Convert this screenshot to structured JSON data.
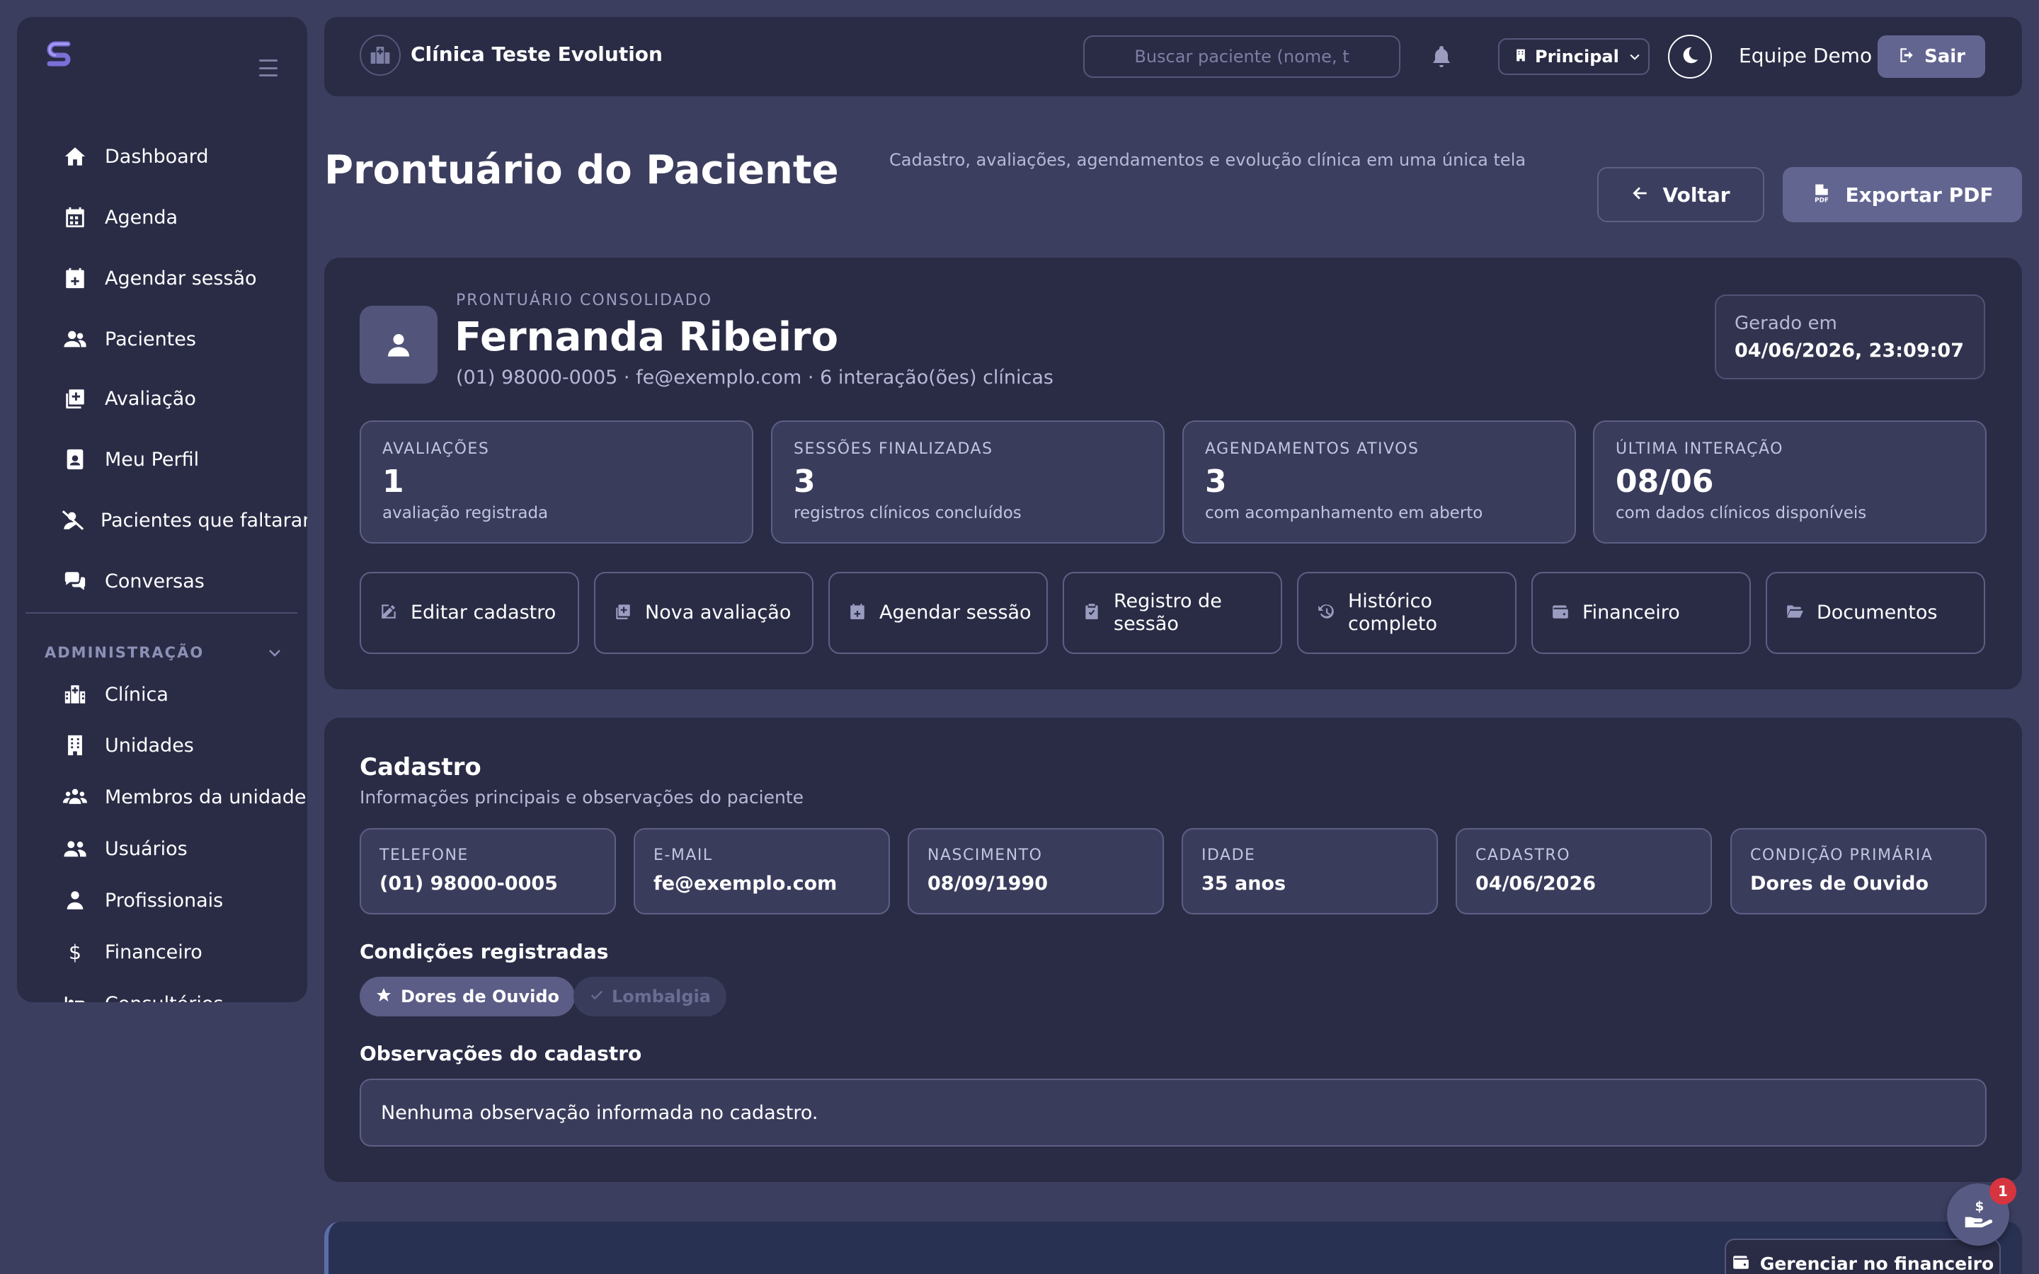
{
  "sidebar": {
    "logo_icon": "stylized-s-logo-icon",
    "main_items": [
      {
        "label": "Dashboard",
        "icon": "home-icon"
      },
      {
        "label": "Agenda",
        "icon": "calendar-icon"
      },
      {
        "label": "Agendar sessão",
        "icon": "calendar-plus-icon"
      },
      {
        "label": "Pacientes",
        "icon": "users-icon"
      },
      {
        "label": "Avaliação",
        "icon": "notes-medical-icon"
      },
      {
        "label": "Meu Perfil",
        "icon": "id-badge-icon"
      },
      {
        "label": "Pacientes que faltaram",
        "icon": "user-slash-icon"
      },
      {
        "label": "Conversas",
        "icon": "comments-icon"
      }
    ],
    "admin_label": "ADMINISTRAÇÃO",
    "admin_items": [
      {
        "label": "Clínica",
        "icon": "hospital-icon"
      },
      {
        "label": "Unidades",
        "icon": "building-icon"
      },
      {
        "label": "Membros da unidade",
        "icon": "users-group-icon"
      },
      {
        "label": "Usuários",
        "icon": "users-cog-icon"
      },
      {
        "label": "Profissionais",
        "icon": "user-md-icon"
      },
      {
        "label": "Financeiro",
        "icon": "dollar-icon"
      },
      {
        "label": "Consultórios",
        "icon": "bed-icon"
      }
    ]
  },
  "topbar": {
    "clinic_name": "Clínica Teste Evolution",
    "search_placeholder": "Buscar paciente (nome, t",
    "unit_label": "Principal",
    "team_label": "Equipe Demo",
    "logout_label": "Sair"
  },
  "page": {
    "title": "Prontuário do Paciente",
    "subtitle": "Cadastro, avaliações, agendamentos e evolução clínica em uma única tela",
    "back_label": "Voltar",
    "export_label": "Exportar PDF"
  },
  "patient": {
    "kicker": "PRONTUÁRIO CONSOLIDADO",
    "name": "Fernanda Ribeiro",
    "meta": "(01) 98000-0005 · fe@exemplo.com · 6 interação(ões) clínicas",
    "generated_label": "Gerado em",
    "generated_value": "04/06/2026, 23:09:07"
  },
  "stats": [
    {
      "label": "AVALIAÇÕES",
      "value": "1",
      "desc": "avaliação registrada"
    },
    {
      "label": "SESSÕES FINALIZADAS",
      "value": "3",
      "desc": "registros clínicos concluídos"
    },
    {
      "label": "AGENDAMENTOS ATIVOS",
      "value": "3",
      "desc": "com acompanhamento em aberto"
    },
    {
      "label": "ÚLTIMA INTERAÇÃO",
      "value": "08/06",
      "desc": "com dados clínicos disponíveis"
    }
  ],
  "actions": [
    {
      "label": "Editar cadastro",
      "icon": "edit-icon"
    },
    {
      "label": "Nova avaliação",
      "icon": "notes-medical-icon"
    },
    {
      "label": "Agendar sessão",
      "icon": "calendar-plus-icon"
    },
    {
      "label": "Registro de sessão",
      "icon": "clipboard-check-icon"
    },
    {
      "label": "Histórico completo",
      "icon": "history-icon"
    },
    {
      "label": "Financeiro",
      "icon": "wallet-icon"
    },
    {
      "label": "Documentos",
      "icon": "folder-open-icon"
    }
  ],
  "cadastro": {
    "title": "Cadastro",
    "subtitle": "Informações principais e observações do paciente",
    "fields": [
      {
        "label": "TELEFONE",
        "value": "(01) 98000-0005"
      },
      {
        "label": "E-MAIL",
        "value": "fe@exemplo.com"
      },
      {
        "label": "NASCIMENTO",
        "value": "08/09/1990"
      },
      {
        "label": "IDADE",
        "value": "35 anos"
      },
      {
        "label": "CADASTRO",
        "value": "04/06/2026"
      },
      {
        "label": "CONDIÇÃO PRIMÁRIA",
        "value": "Dores de Ouvido"
      }
    ],
    "conditions_title": "Condições registradas",
    "conditions": [
      {
        "label": "Dores de Ouvido",
        "icon": "star-icon",
        "primary": true
      },
      {
        "label": "Lombalgia",
        "icon": "check-icon",
        "primary": false
      }
    ],
    "notes_title": "Observações do cadastro",
    "notes_value": "Nenhuma observação informada no cadastro."
  },
  "bottom": {
    "manage_finance_label": "Gerenciar no financeiro",
    "fab_badge": "1",
    "fab_icon": "hand-holding-dollar-icon"
  },
  "colors": {
    "background": "#3c3e5f",
    "panel": "#2a2c46",
    "accent": "#636591",
    "badge": "#d6343f"
  }
}
